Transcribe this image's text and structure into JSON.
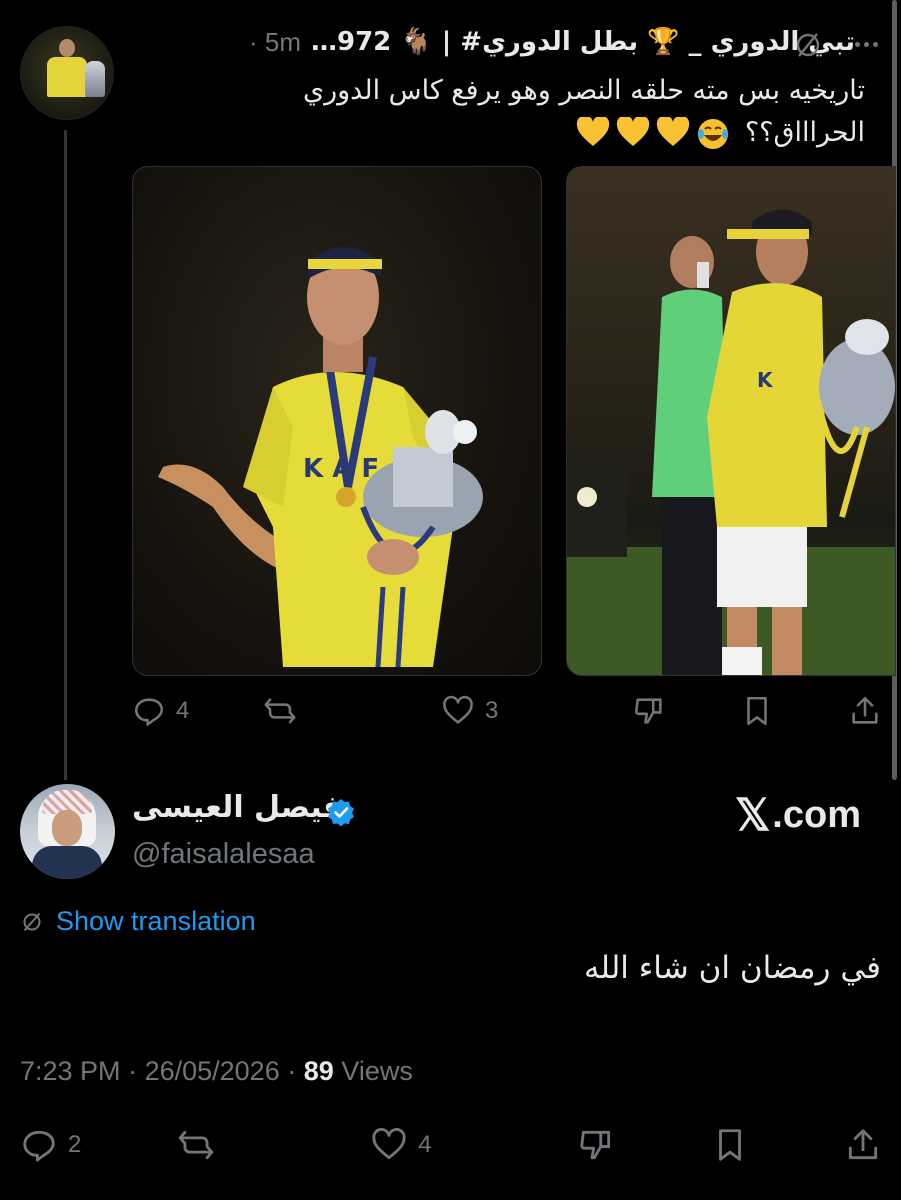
{
  "reply": {
    "display_name": "تبي الدوري _ 🏆 بطل الدوري# | 🐐 972…",
    "time": "5m",
    "text_line1": "تاريخيه بس مته حلقه النصر وهو يرفع كاس الدوري",
    "text_line2": "الحراااق؟؟",
    "emoji_laugh": "laughing-face-icon",
    "emoji_heart": "yellow-heart-icon",
    "actions": {
      "replies": "4",
      "reposts": "",
      "likes": "3"
    }
  },
  "main": {
    "display_name": "فيصل العيسى",
    "handle": "@faisalalesaa",
    "site": ".com",
    "site_mark": "𝕏",
    "translate_label": "Show translation",
    "text": "في رمضان ان شاء الله",
    "time": "7:23 PM",
    "date": "26/05/2026",
    "views_count": "89",
    "views_label": "Views",
    "actions": {
      "replies": "2",
      "reposts": "",
      "likes": "4"
    }
  },
  "colors": {
    "background": "#000000",
    "text": "#e7e9ea",
    "muted": "#71767b",
    "accent": "#1d9bf0",
    "verified": "#1d9bf0"
  }
}
